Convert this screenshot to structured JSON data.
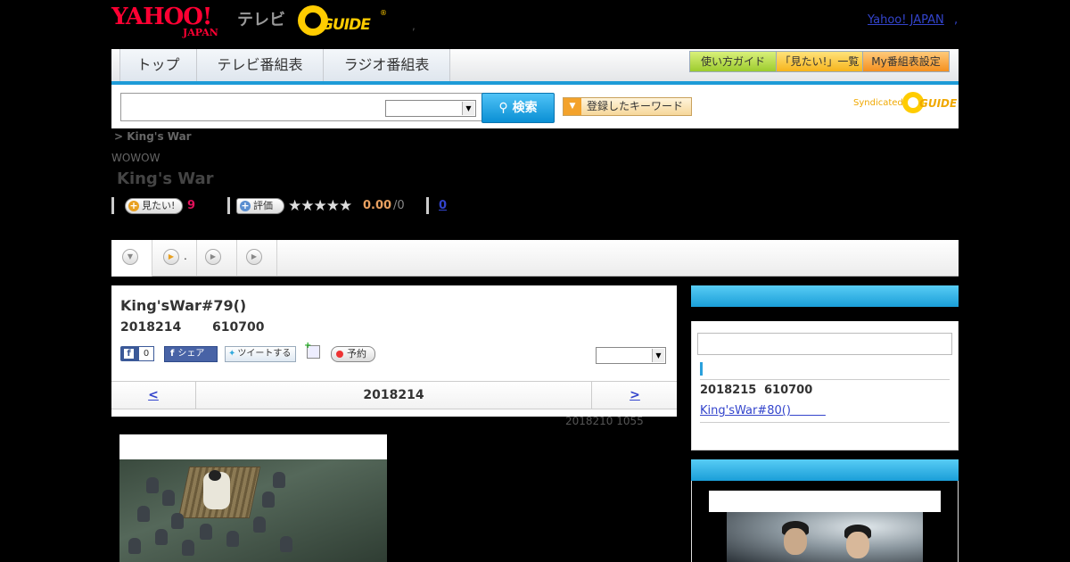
{
  "header": {
    "logo_yahoo": "YAHOO!",
    "logo_yahoo_sub": "JAPAN",
    "logo_tv": "テレビ",
    "logo_gguide": "GUIDE",
    "logo_reg": "®",
    "dot": ",",
    "yahoo_link": "Yahoo! JAPAN",
    "yahoo_link_sep": ","
  },
  "nav": {
    "tabs": [
      "トップ",
      "テレビ番組表",
      "ラジオ番組表"
    ],
    "guide_button": "使い方ガイド",
    "watchlist_button": "「見たい!」一覧",
    "myprogram_button": "My番組表設定"
  },
  "search": {
    "input_value": "",
    "select_value": "",
    "button_label": "検索",
    "keyword_button": "登録したキーワード",
    "syndicated": "Syndicated",
    "syndicated_guide": "GUIDE"
  },
  "program": {
    "breadcrumb": ">  King's War",
    "channel": "WOWOW",
    "title": " King's War",
    "watch_button": "見たい!",
    "watch_count": "9",
    "rate_button": "評価",
    "stars": "★★★★★",
    "rating_score": "0.00",
    "rating_count": "/0",
    "review_link": "0"
  },
  "tabs": {
    "tab2_label": "."
  },
  "episode": {
    "title": "King'sWar#79()",
    "date": "2018214",
    "time": "610700",
    "fb_like_count": "0",
    "fb_share": "シェア",
    "tweet": "ツイートする",
    "reserve": "予約",
    "select_value": "",
    "prev": "<",
    "nav_date": "2018214",
    "next": ">",
    "updated": "2018210  1055"
  },
  "sidebar": {
    "next_date": "2018215",
    "next_time": "610700",
    "next_link": "King'sWar#80()　　　"
  },
  "colors": {
    "accent_blue": "#1e9bd7",
    "link": "#3344cc",
    "watch_count": "#e0105a",
    "rating": "#e8a060"
  }
}
